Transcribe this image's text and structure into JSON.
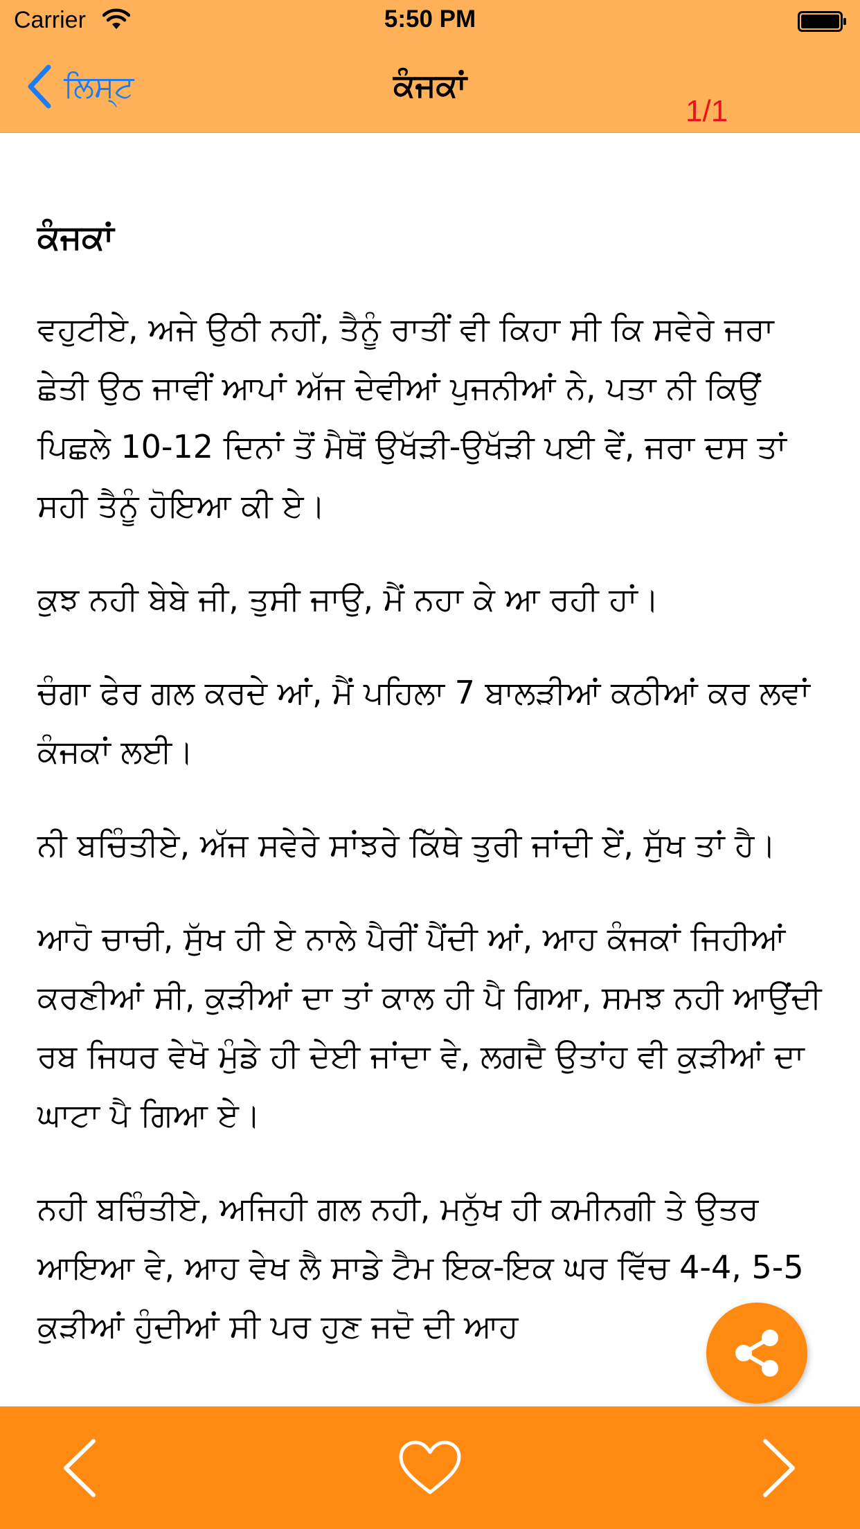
{
  "status_bar": {
    "carrier": "Carrier",
    "time": "5:50 PM"
  },
  "nav": {
    "back_label": "ਲਿਸ੍ਟ",
    "title": "ਕੰਜਕਾਂ",
    "page_counter": "1/1"
  },
  "story": {
    "heading": "ਕੰਜਕਾਂ",
    "paragraphs": [
      "ਵਹੁਟੀਏ, ਅਜੇ ਉਠੀ ਨਹੀਂ, ਤੈਨੂੰ ਰਾਤੀਂ ਵੀ ਕਿਹਾ ਸੀ ਕਿ ਸਵੇਰੇ ਜਰਾ ਛੇਤੀ ਉਠ ਜਾਵੀਂ ਆਪਾਂ ਅੱਜ ਦੇਵੀਆਂ ਪੁਜਨੀਆਂ ਨੇ, ਪਤਾ ਨੀ ਕਿਉਂ ਪਿਛਲੇ 10-12 ਦਿਨਾਂ ਤੋਂ ਮੈਥੋਂ ਉਖੱੜੀ-ਉਖੱੜੀ ਪਈ ਵੇਂ, ਜਰਾ ਦਸ ਤਾਂ ਸਹੀ ਤੈਨੂੰ ਹੋਇਆ ਕੀ ਏ।",
      "ਕੁਝ ਨਹੀ ਬੇਬੇ ਜੀ, ਤੁਸੀ ਜਾਉ, ਮੈਂ ਨਹਾ ਕੇ ਆ ਰਹੀ ਹਾਂ।",
      "ਚੰਗਾ ਫੇਰ ਗਲ ਕਰਦੇ ਆਂ, ਮੈਂ ਪਹਿਲਾ 7 ਬਾਲੜੀਆਂ ਕਠੀਆਂ ਕਰ ਲਵਾਂ ਕੰਜਕਾਂ ਲਈ।",
      "ਨੀ ਬਚਿੰਤੀਏ, ਅੱਜ ਸਵੇਰੇ ਸਾਂਝਰੇ ਕਿੱਥੇ ਤੁਰੀ ਜਾਂਦੀ ਏਂ, ਸੁੱਖ ਤਾਂ ਹੈ।",
      "ਆਹੋ ਚਾਚੀ, ਸੁੱਖ ਹੀ ਏ ਨਾਲੇ ਪੈਰੀਂ ਪੈਂਦੀ ਆਂ, ਆਹ ਕੰਜਕਾਂ ਜਿਹੀਆਂ ਕਰਣੀਆਂ ਸੀ, ਕੁੜੀਆਂ ਦਾ ਤਾਂ ਕਾਲ ਹੀ ਪੈ ਗਿਆ, ਸਮਝ ਨਹੀ ਆਉਂਦੀ ਰਬ ਜਿਧਰ ਵੇਖੋ ਮੁੰਡੇ ਹੀ ਦੇਈ ਜਾਂਦਾ ਵੇ, ਲਗਦੈ ਉਤਾਂਹ ਵੀ ਕੁੜੀਆਂ ਦਾ ਘਾਟਾ ਪੈ ਗਿਆ ਏ।",
      "ਨਹੀ ਬਚਿੰਤੀਏ, ਅਜਿਹੀ ਗਲ ਨਹੀ, ਮਨੁੱਖ ਹੀ ਕਮੀਨਗੀ ਤੇ ਉਤਰ ਆਇਆ ਵੇ, ਆਹ ਵੇਖ ਲੈ ਸਾਡੇ ਟੈਮ ਇਕ-ਇਕ ਘਰ ਵਿੱਚ 4-4, 5-5 ਕੁੜੀਆਂ ਹੁੰਦੀਆਂ ਸੀ ਪਰ ਹੁਣ ਜਦੋ ਦੀ ਆਹ"
    ]
  },
  "icons": {
    "back": "chevron-left-icon",
    "share": "share-icon",
    "prev": "chevron-left-icon",
    "favorite": "heart-outline-icon",
    "next": "chevron-right-icon"
  },
  "colors": {
    "header_bg": "#FEB158",
    "toolbar_bg": "#FF8A12",
    "back_tint": "#1E7CF2",
    "counter": "#E7141D"
  }
}
